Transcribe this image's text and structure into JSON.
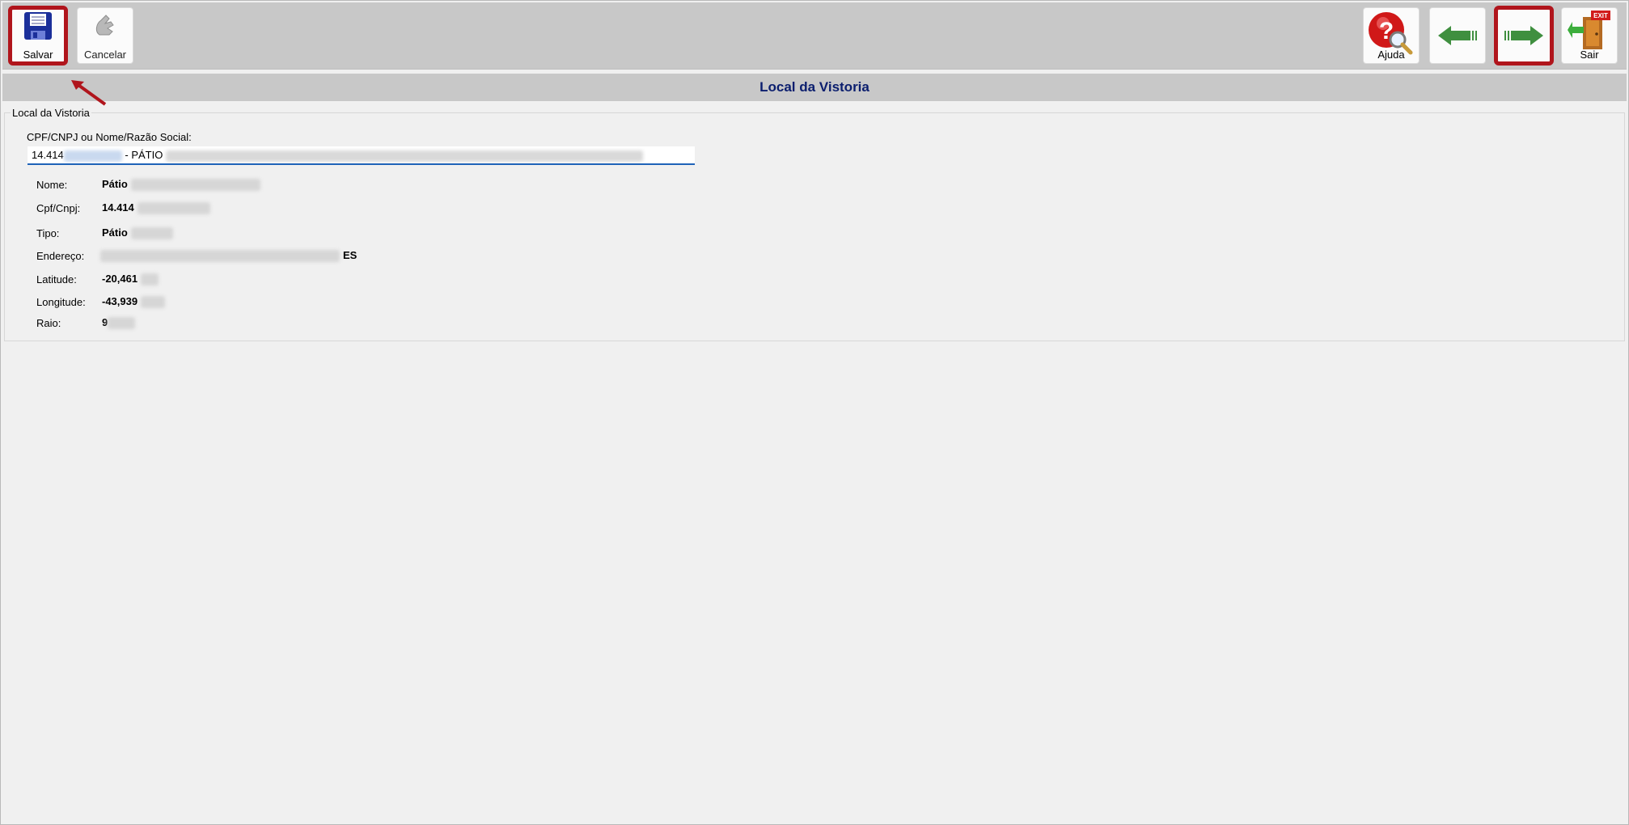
{
  "toolbar": {
    "save_label": "Salvar",
    "cancel_label": "Cancelar",
    "help_label": "Ajuda",
    "exit_label": "Sair",
    "exit_sign_text": "EXIT"
  },
  "header": {
    "title": "Local da Vistoria"
  },
  "group": {
    "legend": "Local da Vistoria",
    "search": {
      "label": "CPF/CNPJ ou Nome/Razão Social:",
      "value_prefix": "14.414",
      "value_middle": "- PÁTIO"
    },
    "details": [
      {
        "label": "Nome:",
        "value": "Pátio"
      },
      {
        "label": "Cpf/Cnpj:",
        "value": "14.414"
      },
      {
        "label": "Tipo:",
        "value": "Pátio"
      },
      {
        "label": "Endereço:",
        "value": "ES"
      },
      {
        "label": "Latitude:",
        "value": "-20,461"
      },
      {
        "label": "Longitude:",
        "value": "-43,939"
      },
      {
        "label": "Raio:",
        "value": "9"
      }
    ]
  },
  "colors": {
    "highlight": "#b0151c",
    "title_text": "#0b1e6e",
    "nav_arrow": "#3f8f3f",
    "input_underline": "#1f63b8"
  }
}
